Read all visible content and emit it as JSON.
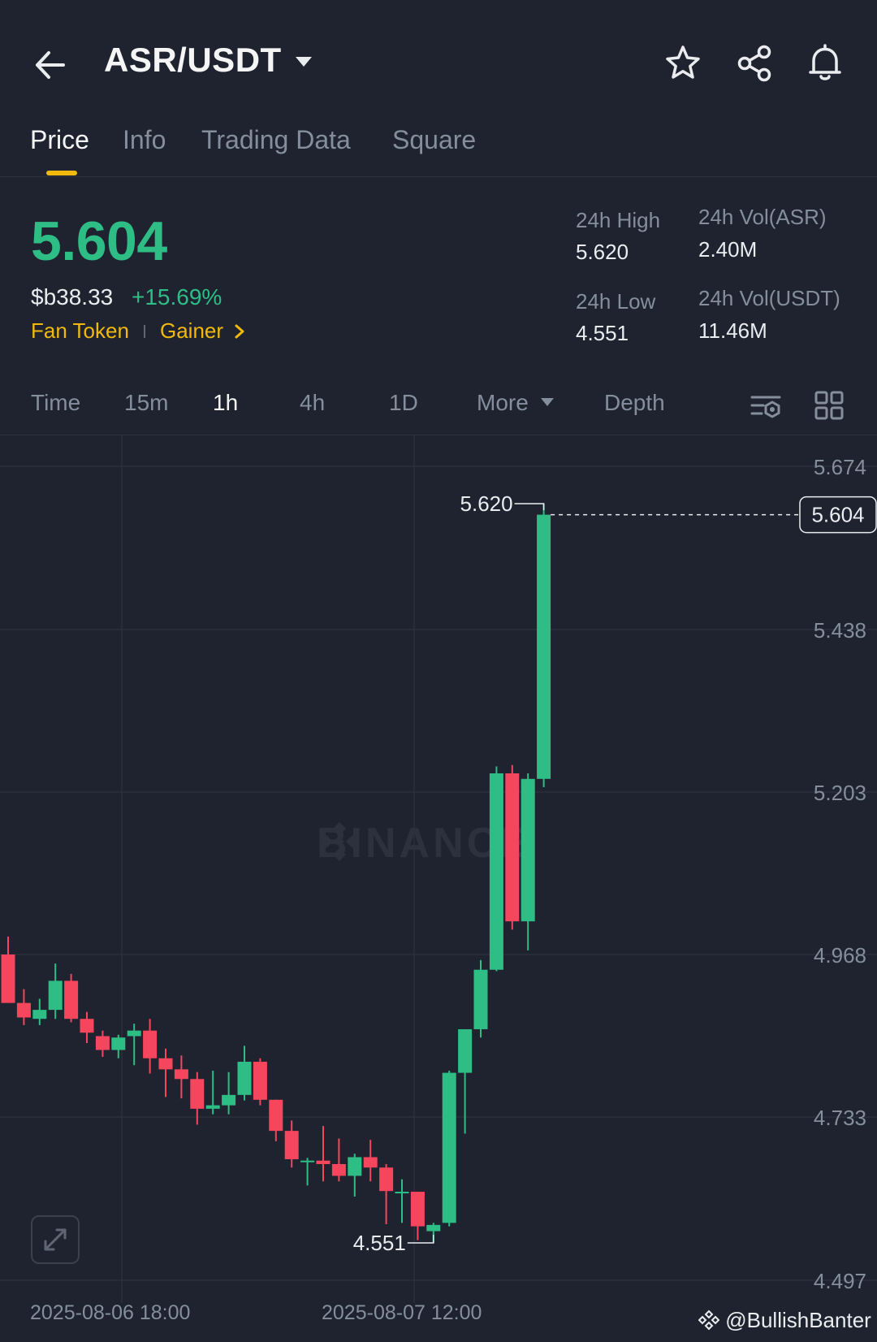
{
  "header": {
    "pair": "ASR/USDT",
    "icons": [
      "back-arrow-icon",
      "caret-down-icon",
      "star-icon",
      "share-icon",
      "bell-icon"
    ]
  },
  "tabs": [
    "Price",
    "Info",
    "Trading Data",
    "Square"
  ],
  "ticker": {
    "last_price": "5.604",
    "fiat_price": "$b38.33",
    "change_pct": "+15.69%",
    "tags": [
      "Fan Token",
      "Gainer"
    ],
    "high_label": "24h High",
    "high_value": "5.620",
    "low_label": "24h Low",
    "low_value": "4.551",
    "vol_base_label": "24h Vol(ASR)",
    "vol_base_value": "2.40M",
    "vol_quote_label": "24h Vol(USDT)",
    "vol_quote_value": "11.46M"
  },
  "intervals": [
    "Time",
    "15m",
    "1h",
    "4h",
    "1D",
    "More",
    "Depth"
  ],
  "active_interval": "1h",
  "colors": {
    "up": "#2ebd85",
    "down": "#f6465d",
    "accent": "#f0b90b"
  },
  "chart_data": {
    "type": "candlestick",
    "ylim": [
      4.497,
      5.674
    ],
    "y_ticks": [
      "5.674",
      "5.438",
      "5.203",
      "4.968",
      "4.733",
      "4.497"
    ],
    "x_ticks": [
      "2025-08-06 18:00",
      "2025-08-07 12:00"
    ],
    "last_price_label": "5.604",
    "high_marker": "5.620",
    "low_marker": "4.551",
    "candles": [
      {
        "o": 4.968,
        "h": 4.994,
        "l": 4.898,
        "c": 4.898
      },
      {
        "o": 4.898,
        "h": 4.918,
        "l": 4.866,
        "c": 4.877
      },
      {
        "o": 4.875,
        "h": 4.904,
        "l": 4.866,
        "c": 4.888
      },
      {
        "o": 4.888,
        "h": 4.955,
        "l": 4.875,
        "c": 4.93
      },
      {
        "o": 4.93,
        "h": 4.94,
        "l": 4.87,
        "c": 4.875
      },
      {
        "o": 4.875,
        "h": 4.885,
        "l": 4.84,
        "c": 4.855
      },
      {
        "o": 4.85,
        "h": 4.858,
        "l": 4.82,
        "c": 4.83
      },
      {
        "o": 4.83,
        "h": 4.852,
        "l": 4.818,
        "c": 4.848
      },
      {
        "o": 4.85,
        "h": 4.868,
        "l": 4.808,
        "c": 4.858
      },
      {
        "o": 4.858,
        "h": 4.875,
        "l": 4.796,
        "c": 4.818
      },
      {
        "o": 4.818,
        "h": 4.832,
        "l": 4.762,
        "c": 4.802
      },
      {
        "o": 4.802,
        "h": 4.822,
        "l": 4.76,
        "c": 4.788
      },
      {
        "o": 4.788,
        "h": 4.798,
        "l": 4.722,
        "c": 4.745
      },
      {
        "o": 4.745,
        "h": 4.8,
        "l": 4.737,
        "c": 4.75
      },
      {
        "o": 4.75,
        "h": 4.798,
        "l": 4.737,
        "c": 4.765
      },
      {
        "o": 4.765,
        "h": 4.836,
        "l": 4.757,
        "c": 4.813
      },
      {
        "o": 4.813,
        "h": 4.818,
        "l": 4.75,
        "c": 4.758
      },
      {
        "o": 4.758,
        "h": 4.758,
        "l": 4.698,
        "c": 4.713
      },
      {
        "o": 4.713,
        "h": 4.728,
        "l": 4.66,
        "c": 4.672
      },
      {
        "o": 4.67,
        "h": 4.674,
        "l": 4.634,
        "c": 4.67
      },
      {
        "o": 4.67,
        "h": 4.72,
        "l": 4.64,
        "c": 4.665
      },
      {
        "o": 4.665,
        "h": 4.702,
        "l": 4.64,
        "c": 4.648
      },
      {
        "o": 4.648,
        "h": 4.68,
        "l": 4.618,
        "c": 4.675
      },
      {
        "o": 4.675,
        "h": 4.7,
        "l": 4.64,
        "c": 4.66
      },
      {
        "o": 4.66,
        "h": 4.665,
        "l": 4.578,
        "c": 4.626
      },
      {
        "o": 4.625,
        "h": 4.643,
        "l": 4.58,
        "c": 4.625
      },
      {
        "o": 4.625,
        "h": 4.625,
        "l": 4.555,
        "c": 4.575
      },
      {
        "o": 4.568,
        "h": 4.58,
        "l": 4.551,
        "c": 4.577
      },
      {
        "o": 4.58,
        "h": 4.8,
        "l": 4.575,
        "c": 4.797
      },
      {
        "o": 4.797,
        "h": 4.86,
        "l": 4.709,
        "c": 4.86
      },
      {
        "o": 4.86,
        "h": 4.96,
        "l": 4.848,
        "c": 4.946
      },
      {
        "o": 4.946,
        "h": 5.24,
        "l": 4.944,
        "c": 5.23
      },
      {
        "o": 5.23,
        "h": 5.242,
        "l": 5.004,
        "c": 5.016
      },
      {
        "o": 5.016,
        "h": 5.23,
        "l": 4.974,
        "c": 5.222
      },
      {
        "o": 5.222,
        "h": 5.62,
        "l": 5.21,
        "c": 5.604
      }
    ]
  },
  "watermark": "BINANCE",
  "credit": "@BullishBanter"
}
